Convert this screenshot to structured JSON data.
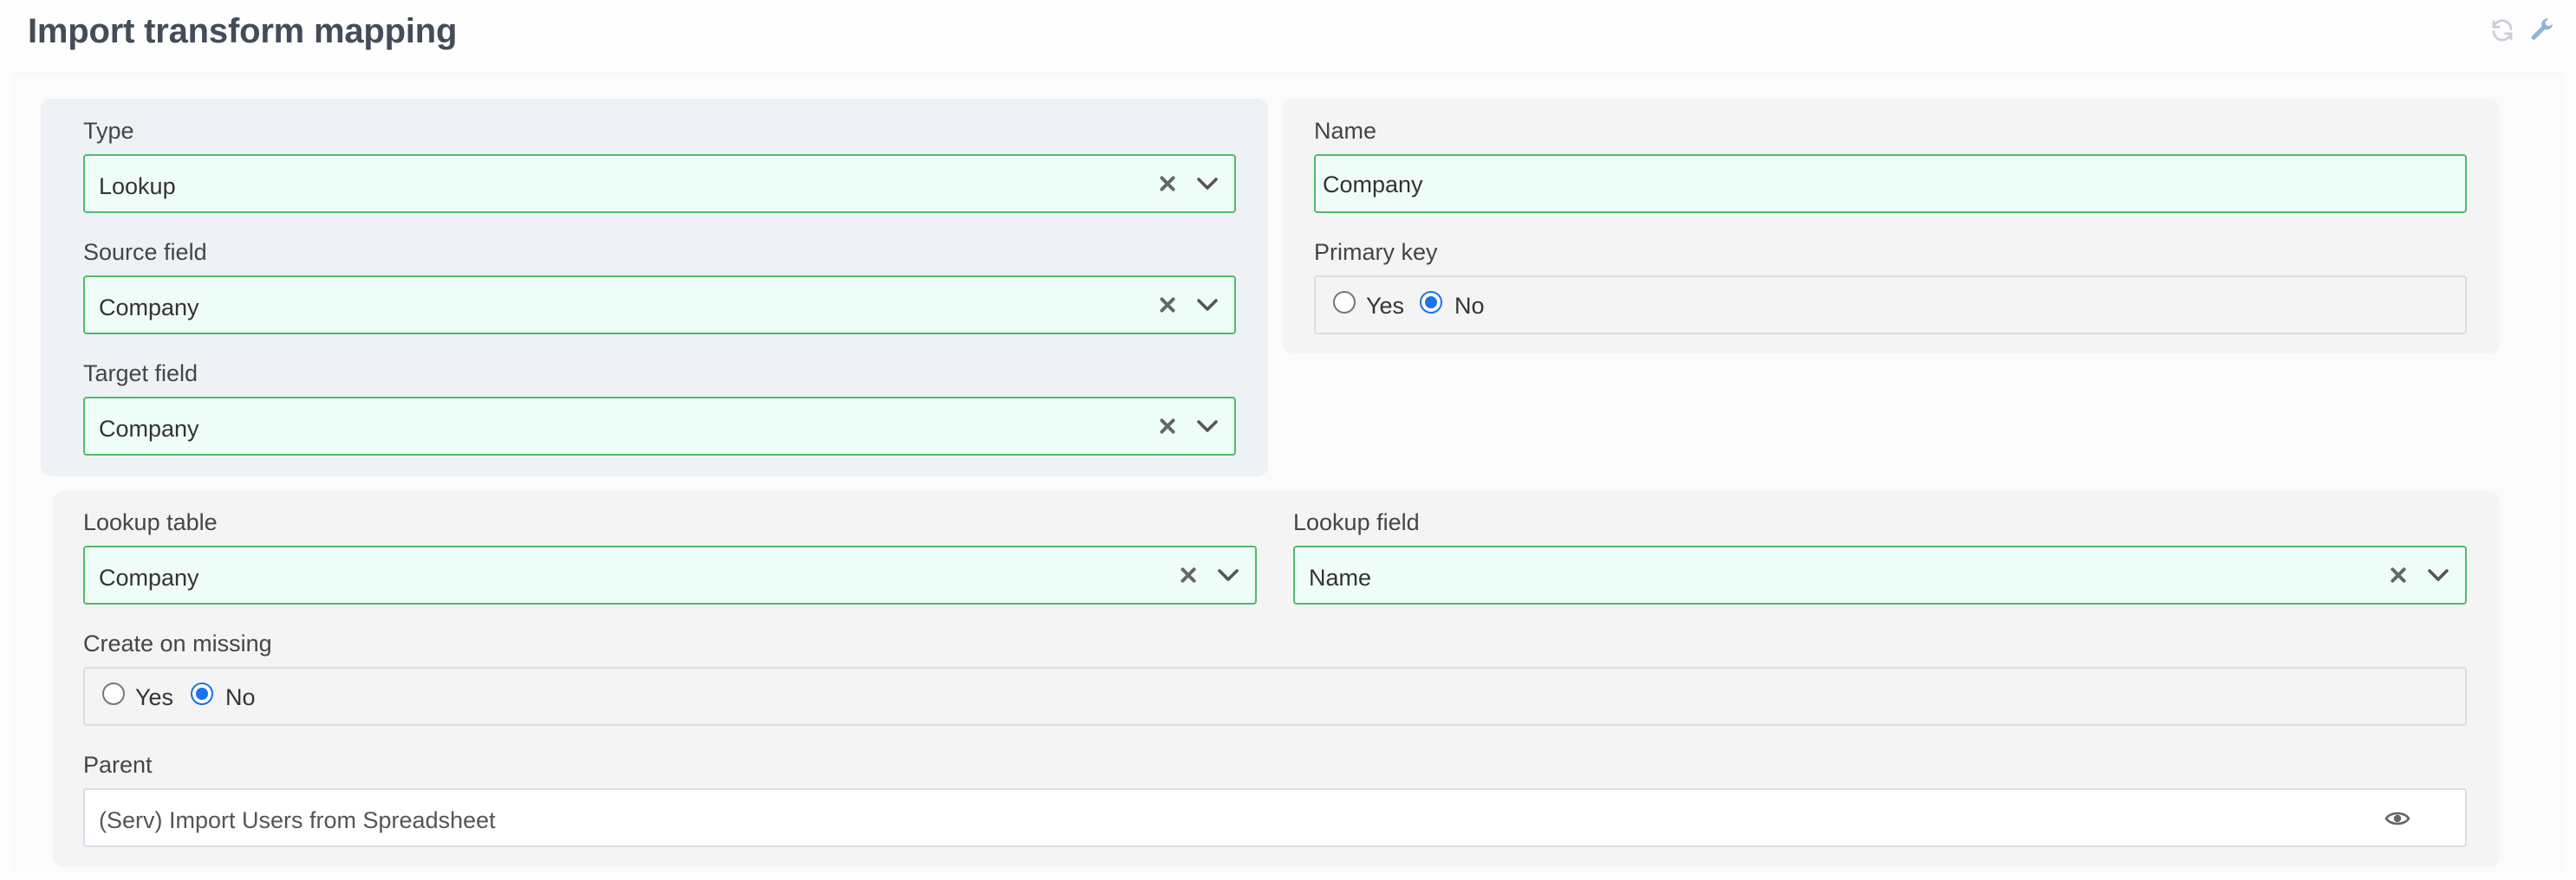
{
  "page": {
    "title": "Import transform mapping"
  },
  "header_icons": {
    "refresh": "refresh-icon",
    "settings": "wrench-icon"
  },
  "form": {
    "type": {
      "label": "Type",
      "value": "Lookup"
    },
    "source_field": {
      "label": "Source field",
      "value": "Company"
    },
    "target_field": {
      "label": "Target field",
      "value": "Company"
    },
    "name": {
      "label": "Name",
      "value": "Company"
    },
    "primary_key": {
      "label": "Primary key",
      "options": [
        "Yes",
        "No"
      ],
      "selected": "No"
    },
    "lookup_table": {
      "label": "Lookup table",
      "value": "Company"
    },
    "lookup_field": {
      "label": "Lookup field",
      "value": "Name"
    },
    "create_on_missing": {
      "label": "Create on missing",
      "options": [
        "Yes",
        "No"
      ],
      "selected": "No"
    },
    "parent": {
      "label": "Parent",
      "value": "(Serv) Import Users from Spreadsheet"
    }
  },
  "colors": {
    "field_border_valid": "#4fba6a",
    "field_bg_valid": "#effdf9",
    "radio_accent": "#1a73e8",
    "title": "#444c5a"
  }
}
